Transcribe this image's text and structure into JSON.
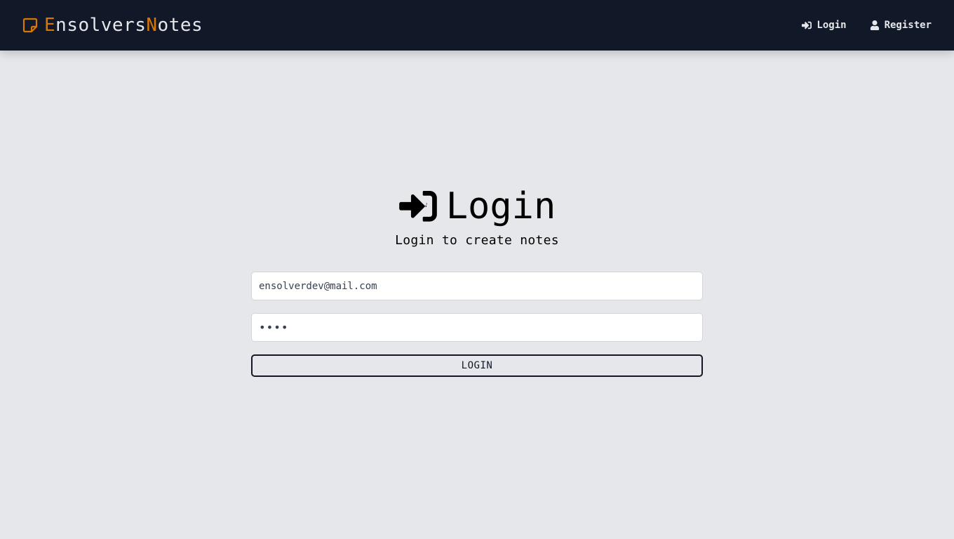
{
  "brand": {
    "icon": "sticky-note-icon",
    "first_initial": "E",
    "first_rest": "nsolvers",
    "second_initial": "N",
    "second_rest": "otes",
    "accent_color": "#d97706"
  },
  "nav": {
    "login": {
      "label": "Login",
      "icon": "sign-in-icon"
    },
    "register": {
      "label": "Register",
      "icon": "user-icon"
    }
  },
  "heading": {
    "icon": "sign-in-icon",
    "title": "Login",
    "subtitle": "Login to create notes"
  },
  "form": {
    "email_value": "ensolverdev@mail.com",
    "password_value": "1234",
    "submit_label": "LOGIN"
  },
  "colors": {
    "navbar_bg": "#111827",
    "page_bg": "#e5e7eb",
    "text_light": "#e5e7eb"
  }
}
